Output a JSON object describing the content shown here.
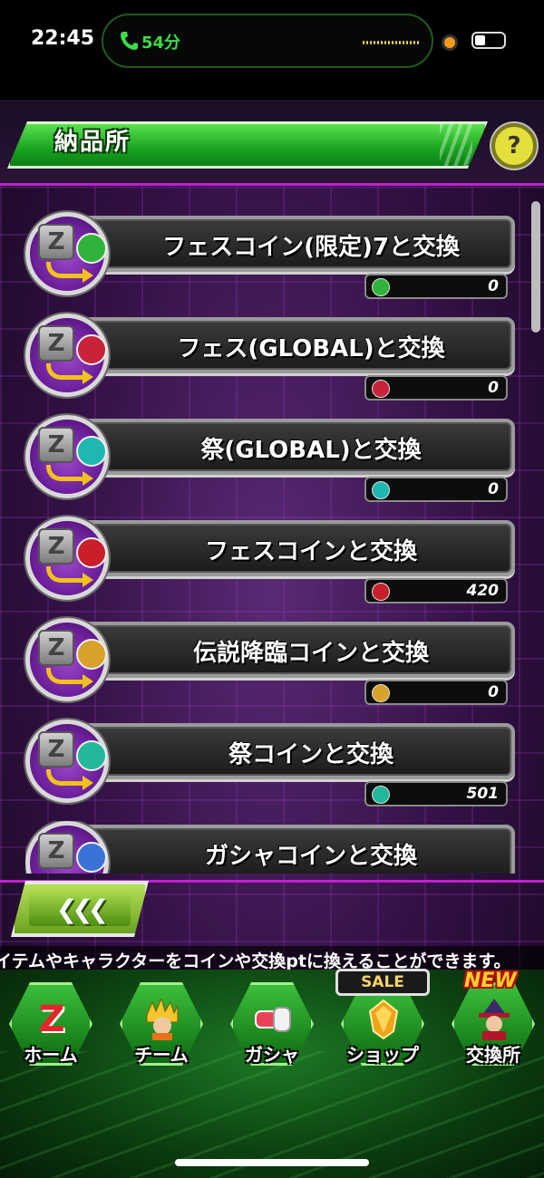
{
  "status_bar": {
    "time": "22:45",
    "call_duration": "54分"
  },
  "header": {
    "title": "納品所",
    "help_label": "?"
  },
  "exchange_items": [
    {
      "label": "フェスコイン(限定)7と交換",
      "count": "0",
      "coin_color": "#2fb33a"
    },
    {
      "label": "フェス(GLOBAL)と交換",
      "count": "0",
      "coin_color": "#c8233a"
    },
    {
      "label": "祭(GLOBAL)と交換",
      "count": "0",
      "coin_color": "#1fb7b2"
    },
    {
      "label": "フェスコインと交換",
      "count": "420",
      "coin_color": "#c81f2a"
    },
    {
      "label": "伝説降臨コインと交換",
      "count": "0",
      "coin_color": "#d8a12a"
    },
    {
      "label": "祭コインと交換",
      "count": "501",
      "coin_color": "#22b89a"
    },
    {
      "label": "ガシャコインと交換",
      "count": "",
      "coin_color": "#3a72d8"
    }
  ],
  "back_button": {
    "label": "❮❮❮"
  },
  "marquee": {
    "text": "イテムやキャラクターをコインや交換ptに換えることができます。"
  },
  "nav": {
    "home": "ホーム",
    "team": "チーム",
    "gacha": "ガシャ",
    "shop": "ショップ",
    "exchange": "交換所",
    "sale_badge": "SALE",
    "new_badge": "NEW"
  },
  "home_icon_letter": "Z",
  "z_letter": "Z"
}
